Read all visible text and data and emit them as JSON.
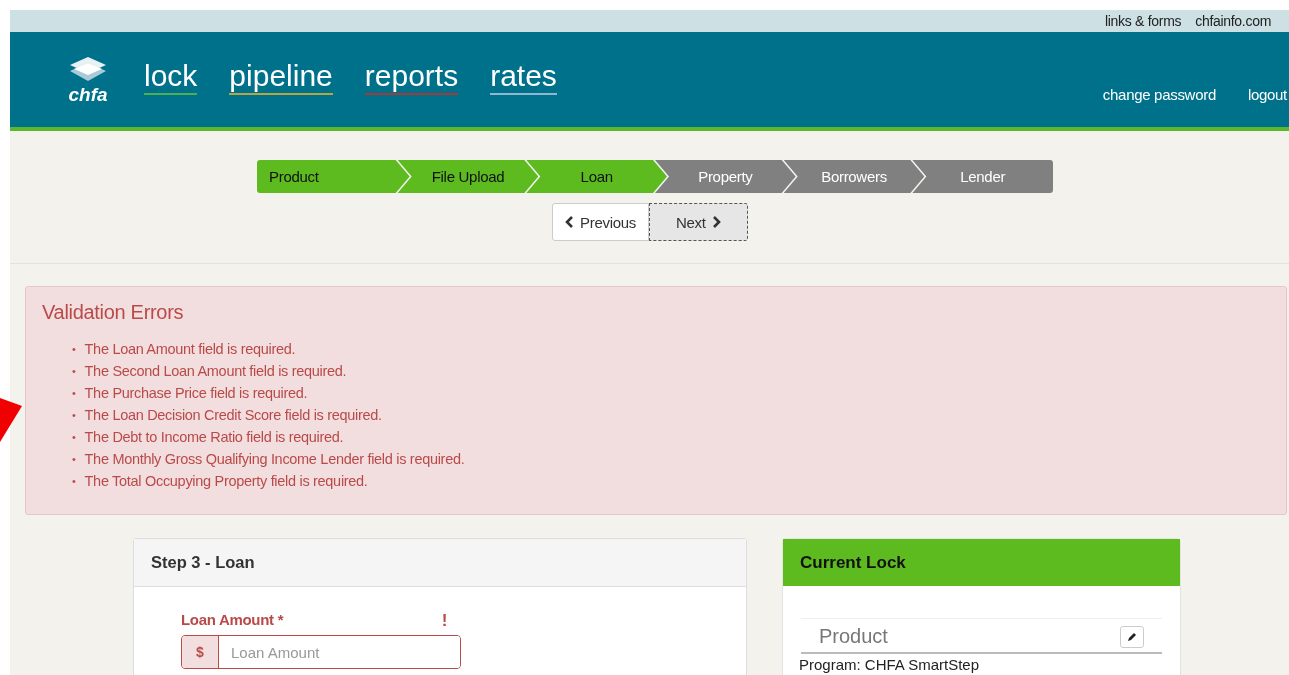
{
  "top_links": [
    "links & forms",
    "chfainfo.com"
  ],
  "logo": {
    "text": "chfa"
  },
  "nav": [
    {
      "label": "lock",
      "color": "#4caf50"
    },
    {
      "label": "pipeline",
      "color": "#b5a642"
    },
    {
      "label": "reports",
      "color": "#a33a3a"
    },
    {
      "label": "rates",
      "color": "#8fb8d0"
    }
  ],
  "account_links": [
    "change password",
    "logout"
  ],
  "steps": [
    {
      "label": "Product",
      "done": true
    },
    {
      "label": "File Upload",
      "done": true
    },
    {
      "label": "Loan",
      "done": true
    },
    {
      "label": "Property",
      "done": false
    },
    {
      "label": "Borrowers",
      "done": false
    },
    {
      "label": "Lender",
      "done": false
    }
  ],
  "pager": [
    {
      "label": "Previous",
      "kind": "prev",
      "focused": false
    },
    {
      "label": "Next",
      "kind": "next",
      "focused": true
    }
  ],
  "validation": {
    "title": "Validation Errors",
    "bullet": "•",
    "errors": [
      "The Loan Amount field is required.",
      "The Second Loan Amount field is required.",
      "The Purchase Price field is required.",
      "The Loan Decision Credit Score field is required.",
      "The Debt to Income Ratio field is required.",
      "The Monthly Gross Qualifying Income Lender field is required.",
      "The Total Occupying Property field is required."
    ]
  },
  "step_card": {
    "title": "Step 3 - Loan",
    "field": {
      "label": "Loan Amount",
      "required_mark": "*",
      "error_mark": "!",
      "prefix": "$",
      "placeholder": "Loan Amount"
    }
  },
  "lock_card": {
    "title": "Current Lock",
    "section": "Product",
    "line": "Program: CHFA SmartStep"
  }
}
